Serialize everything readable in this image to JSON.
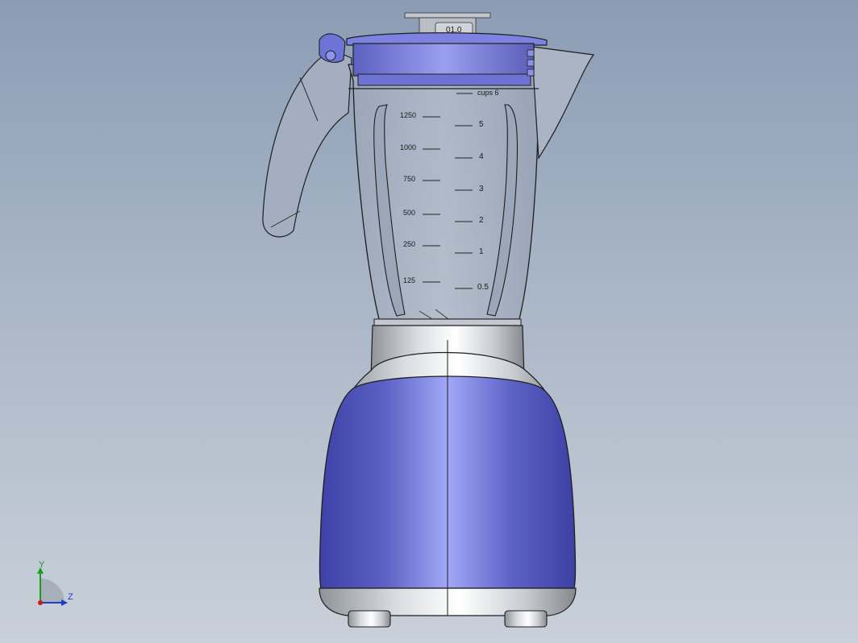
{
  "viewport": {
    "background_top": "#8b9cb4",
    "background_bottom": "#c9d0d9"
  },
  "colors": {
    "accent_blue": "#6a6fd0",
    "glass": "#a9b4c4",
    "silver": "#d6d9dd",
    "outline": "#222222"
  },
  "model": {
    "lid_label": "01.0",
    "cups_label": "cups 6",
    "left_scale": [
      "1250",
      "1000",
      "750",
      "500",
      "250",
      "125"
    ],
    "right_scale": [
      "5",
      "4",
      "3",
      "2",
      "1",
      "0.5"
    ]
  },
  "triad": {
    "y_label": "Y",
    "z_label": "Z"
  }
}
